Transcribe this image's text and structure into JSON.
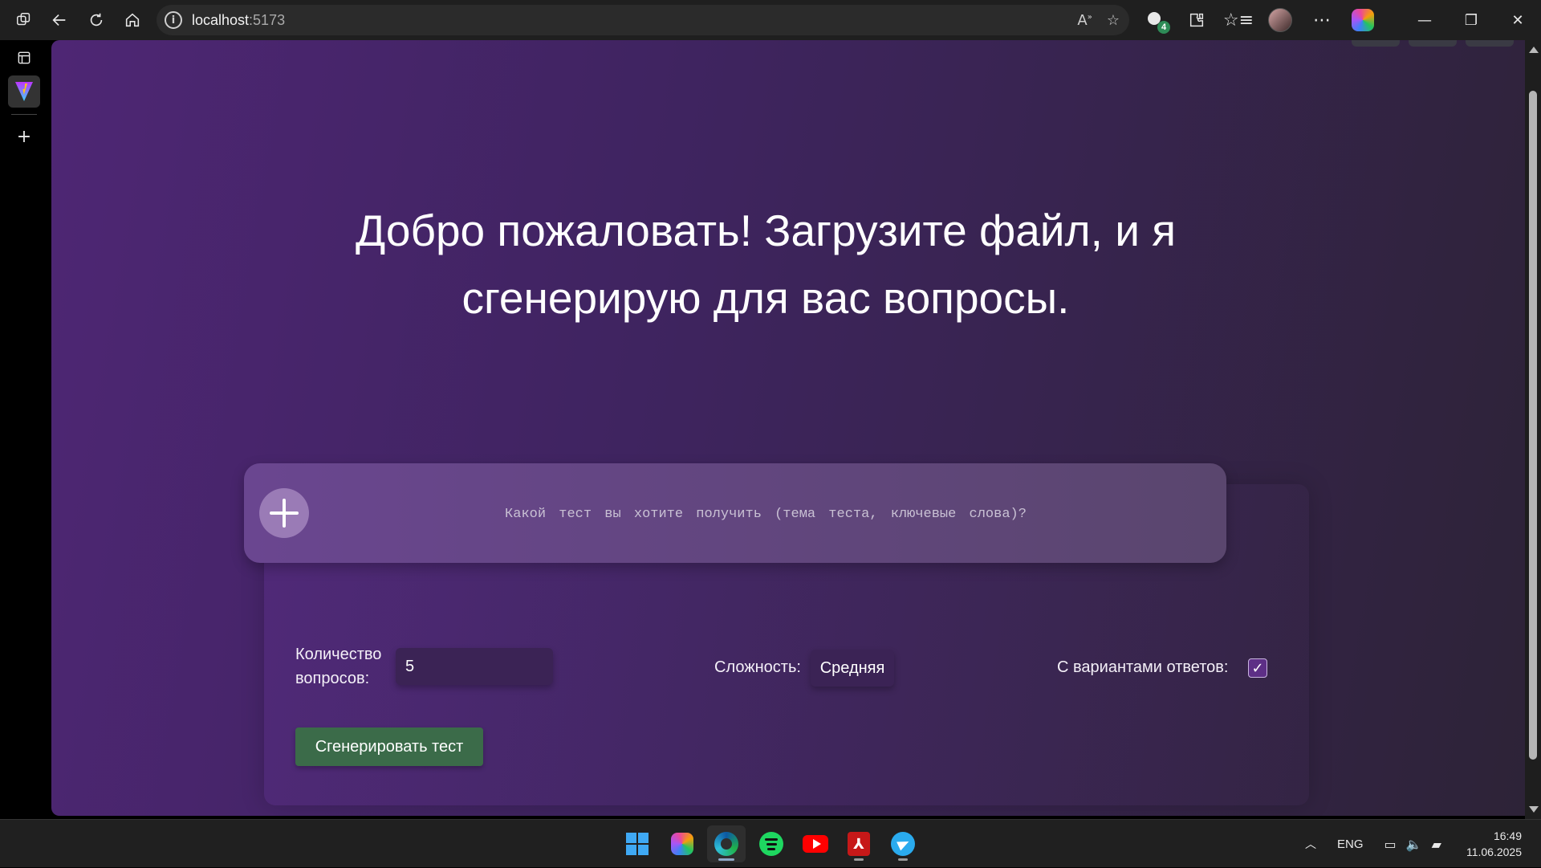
{
  "browser": {
    "url_host": "localhost",
    "url_port": ":5173",
    "extensions_badge": "4"
  },
  "page": {
    "headline_line1": "Добро пожаловать! Загрузите файл, и я",
    "headline_line2": "сгенерирую для вас вопросы.",
    "prompt_placeholder": "Какой тест вы хотите получить (тема теста, ключевые слова)?",
    "count_label_line1": "Количество",
    "count_label_line2": "вопросов:",
    "count_value": "5",
    "difficulty_label": "Сложность:",
    "difficulty_value": "Средняя",
    "options_label": "С вариантами ответов:",
    "options_checked": true,
    "generate_button": "Сгенерировать тест"
  },
  "taskbar": {
    "apps": [
      "start",
      "copilot",
      "edge",
      "spotify",
      "youtube",
      "acrobat",
      "telegram"
    ],
    "language": "ENG",
    "time": "16:49",
    "date": "11.06.2025"
  },
  "colors": {
    "page_gradient_start": "#4e2674",
    "page_gradient_end": "#2d2337",
    "generate_button_bg": "#3b6b49",
    "prompt_bg": "#6a4690",
    "checkbox_bg": "#5d2f86"
  }
}
